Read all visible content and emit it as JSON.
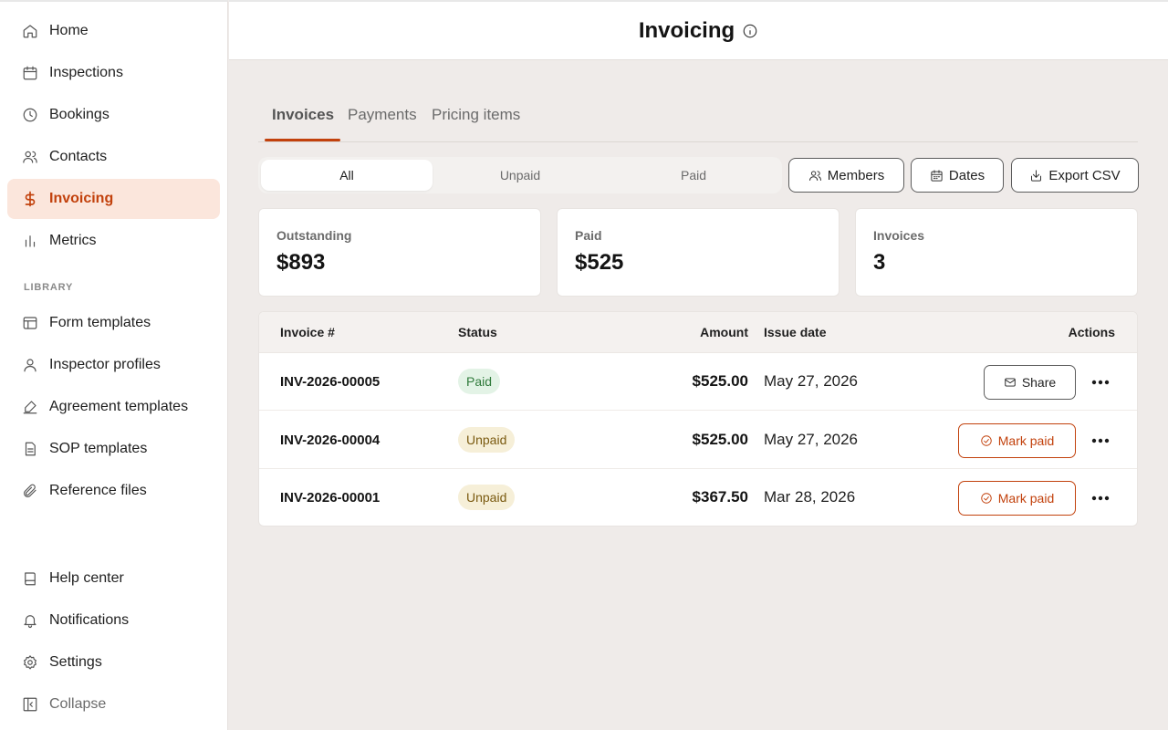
{
  "sidebar": {
    "items": [
      {
        "label": "Home",
        "icon": "home-icon"
      },
      {
        "label": "Inspections",
        "icon": "calendar-icon"
      },
      {
        "label": "Bookings",
        "icon": "clock-icon"
      },
      {
        "label": "Contacts",
        "icon": "users-icon"
      },
      {
        "label": "Invoicing",
        "icon": "dollar-icon",
        "active": true
      },
      {
        "label": "Metrics",
        "icon": "bar-chart-icon"
      }
    ],
    "library_label": "LIBRARY",
    "library_items": [
      {
        "label": "Form templates",
        "icon": "layout-icon"
      },
      {
        "label": "Inspector profiles",
        "icon": "user-icon"
      },
      {
        "label": "Agreement templates",
        "icon": "signature-icon"
      },
      {
        "label": "SOP templates",
        "icon": "document-icon"
      },
      {
        "label": "Reference files",
        "icon": "paperclip-icon"
      }
    ],
    "footer_items": [
      {
        "label": "Help center",
        "icon": "book-icon"
      },
      {
        "label": "Notifications",
        "icon": "bell-icon"
      },
      {
        "label": "Settings",
        "icon": "gear-icon"
      },
      {
        "label": "Collapse",
        "icon": "sidebar-collapse-icon"
      }
    ]
  },
  "header": {
    "title": "Invoicing",
    "info_icon": "info-icon"
  },
  "tabs": [
    {
      "label": "Invoices",
      "active": true
    },
    {
      "label": "Payments"
    },
    {
      "label": "Pricing items"
    }
  ],
  "filter": {
    "options": [
      "All",
      "Unpaid",
      "Paid"
    ],
    "selected": "All"
  },
  "toolbar": {
    "members_label": "Members",
    "dates_label": "Dates",
    "export_label": "Export CSV"
  },
  "stats": [
    {
      "label": "Outstanding",
      "value": "$893"
    },
    {
      "label": "Paid",
      "value": "$525"
    },
    {
      "label": "Invoices",
      "value": "3"
    }
  ],
  "table": {
    "headers": {
      "invoice": "Invoice #",
      "status": "Status",
      "amount": "Amount",
      "issue_date": "Issue date",
      "actions": "Actions"
    },
    "rows": [
      {
        "invoice": "INV-2026-00005",
        "status": "Paid",
        "amount": "$525.00",
        "date": "May 27, 2026",
        "action": "Share"
      },
      {
        "invoice": "INV-2026-00004",
        "status": "Unpaid",
        "amount": "$525.00",
        "date": "May 27, 2026",
        "action": "Mark paid"
      },
      {
        "invoice": "INV-2026-00001",
        "status": "Unpaid",
        "amount": "$367.50",
        "date": "Mar 28, 2026",
        "action": "Mark paid"
      }
    ]
  },
  "colors": {
    "accent": "#c2410c",
    "active_bg": "#fbe6dc",
    "paid_bg": "#e3f3e6",
    "unpaid_bg": "#f6efd8"
  }
}
